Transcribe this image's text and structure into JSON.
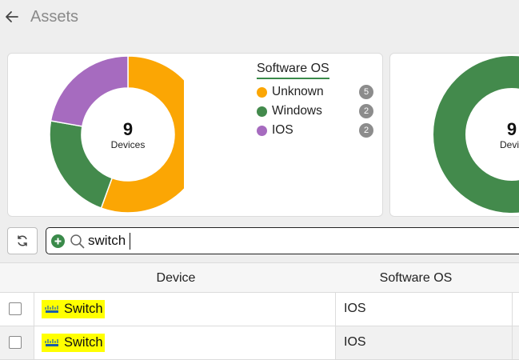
{
  "header": {
    "title": "Assets"
  },
  "cards": [
    {
      "legend_title": "Software OS",
      "center_value": "9",
      "center_label": "Devices",
      "chart_data": {
        "type": "pie",
        "title": "Software OS",
        "categories": [
          "Unknown",
          "Windows",
          "IOS"
        ],
        "values": [
          5,
          2,
          2
        ],
        "colors": [
          "#fba604",
          "#438a4c",
          "#a66bbf"
        ],
        "legend": "right"
      }
    },
    {
      "center_value": "9",
      "center_label": "Devic",
      "chart_data": {
        "type": "pie",
        "values": [
          9
        ],
        "colors": [
          "#438a4c"
        ]
      }
    }
  ],
  "search": {
    "value": "switch"
  },
  "table": {
    "columns": [
      "Device",
      "Software OS"
    ],
    "rows": [
      {
        "device": "Switch",
        "os": "IOS"
      },
      {
        "device": "Switch",
        "os": "IOS"
      }
    ]
  }
}
